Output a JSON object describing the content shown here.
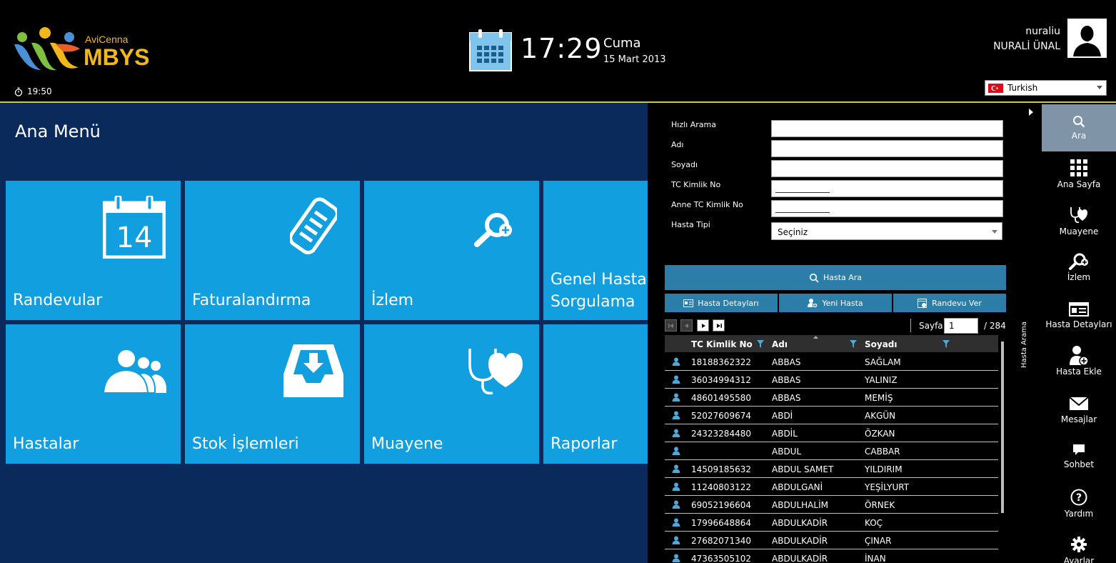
{
  "header": {
    "logo_small": "AviCenna",
    "logo_big": "MBYS",
    "session_time": "19:50",
    "clock": "17:29",
    "day_name": "Cuma",
    "date": "15 Mart 2013",
    "user_login": "nuraliu",
    "user_fullname": "NURALİ ÜNAL",
    "language": "Turkish"
  },
  "main": {
    "title": "Ana Menü",
    "tiles": [
      {
        "label": "Randevular",
        "icon": "calendar-icon",
        "calendar_day": "14"
      },
      {
        "label": "Faturalandırma",
        "icon": "invoice-scroll-icon"
      },
      {
        "label": "İzlem",
        "icon": "search-plus-icon"
      },
      {
        "label": "Genel Hasta Sorgulama",
        "line1": "Genel Hasta",
        "line2": "Sorgulama",
        "icon": "none"
      },
      {
        "label": "Hastalar",
        "icon": "patients-group-icon"
      },
      {
        "label": "Stok İşlemleri",
        "icon": "inbox-download-icon"
      },
      {
        "label": "Muayene",
        "icon": "stethoscope-heart-icon"
      },
      {
        "label": "Raporlar",
        "icon": "none"
      }
    ]
  },
  "search": {
    "fields": [
      {
        "label": "Hızlı Arama",
        "value": ""
      },
      {
        "label": "Adı",
        "value": ""
      },
      {
        "label": "Soyadı",
        "value": ""
      },
      {
        "label": "TC Kimlik No",
        "value": ""
      },
      {
        "label": "Anne TC Kimlik No",
        "value": ""
      }
    ],
    "hasta_tipi_label": "Hasta Tipi",
    "hasta_tipi_value": "Seçiniz",
    "search_button": "Hasta Ara",
    "buttons": [
      "Hasta Detayları",
      "Yeni Hasta",
      "Randevu Ver"
    ],
    "pager": {
      "label": "Sayfa",
      "current": "1",
      "total": "/ 284"
    },
    "grid": {
      "headers": [
        "TC Kimlik No",
        "Adı",
        "Soyadı"
      ],
      "rows": [
        {
          "tc": "18188362322",
          "ad": "ABBAS",
          "soyad": "SAĞLAM"
        },
        {
          "tc": "36034994312",
          "ad": "ABBAS",
          "soyad": "YALINIZ"
        },
        {
          "tc": "48601495580",
          "ad": "ABBAS",
          "soyad": "MEMİŞ"
        },
        {
          "tc": "52027609674",
          "ad": "ABDİ",
          "soyad": "AKGÜN"
        },
        {
          "tc": "24323284480",
          "ad": "ABDİL",
          "soyad": "ÖZKAN"
        },
        {
          "tc": "",
          "ad": "ABDUL",
          "soyad": "CABBAR"
        },
        {
          "tc": "14509185632",
          "ad": "ABDUL SAMET",
          "soyad": "YILDIRIM"
        },
        {
          "tc": "11240803122",
          "ad": "ABDULGANİ",
          "soyad": "YEŞİLYURT"
        },
        {
          "tc": "69052196604",
          "ad": "ABDULHALİM",
          "soyad": "ÖRNEK"
        },
        {
          "tc": "17996648864",
          "ad": "ABDULKADİR",
          "soyad": "KOÇ"
        },
        {
          "tc": "27682071340",
          "ad": "ABDULKADİR",
          "soyad": "ÇINAR"
        },
        {
          "tc": "47363505102",
          "ad": "ABDULKADİR",
          "soyad": "İNAN"
        }
      ]
    },
    "side_tab": "Hasta Arama"
  },
  "sidebar": {
    "items": [
      {
        "label": "Ara",
        "icon": "search-icon",
        "active": true
      },
      {
        "label": "Ana Sayfa",
        "icon": "grid-icon"
      },
      {
        "label": "Muayene",
        "icon": "stethoscope-icon"
      },
      {
        "label": "İzlem",
        "icon": "search-plus-icon"
      },
      {
        "label": "Hasta Detayları",
        "icon": "id-card-icon"
      },
      {
        "label": "Hasta Ekle",
        "icon": "add-user-icon"
      },
      {
        "label": "Mesajlar",
        "icon": "envelope-icon"
      },
      {
        "label": "Sohbet",
        "icon": "chat-icon"
      },
      {
        "label": "Yardım",
        "icon": "help-icon"
      },
      {
        "label": "Ayarlar",
        "icon": "gear-icon"
      }
    ]
  },
  "colors": {
    "tile": "#119fdf",
    "panel": "#0b2a5c",
    "button": "#2c7ea8",
    "accent_line": "#c9c94a",
    "active_sidebar": "#7f95a7"
  }
}
